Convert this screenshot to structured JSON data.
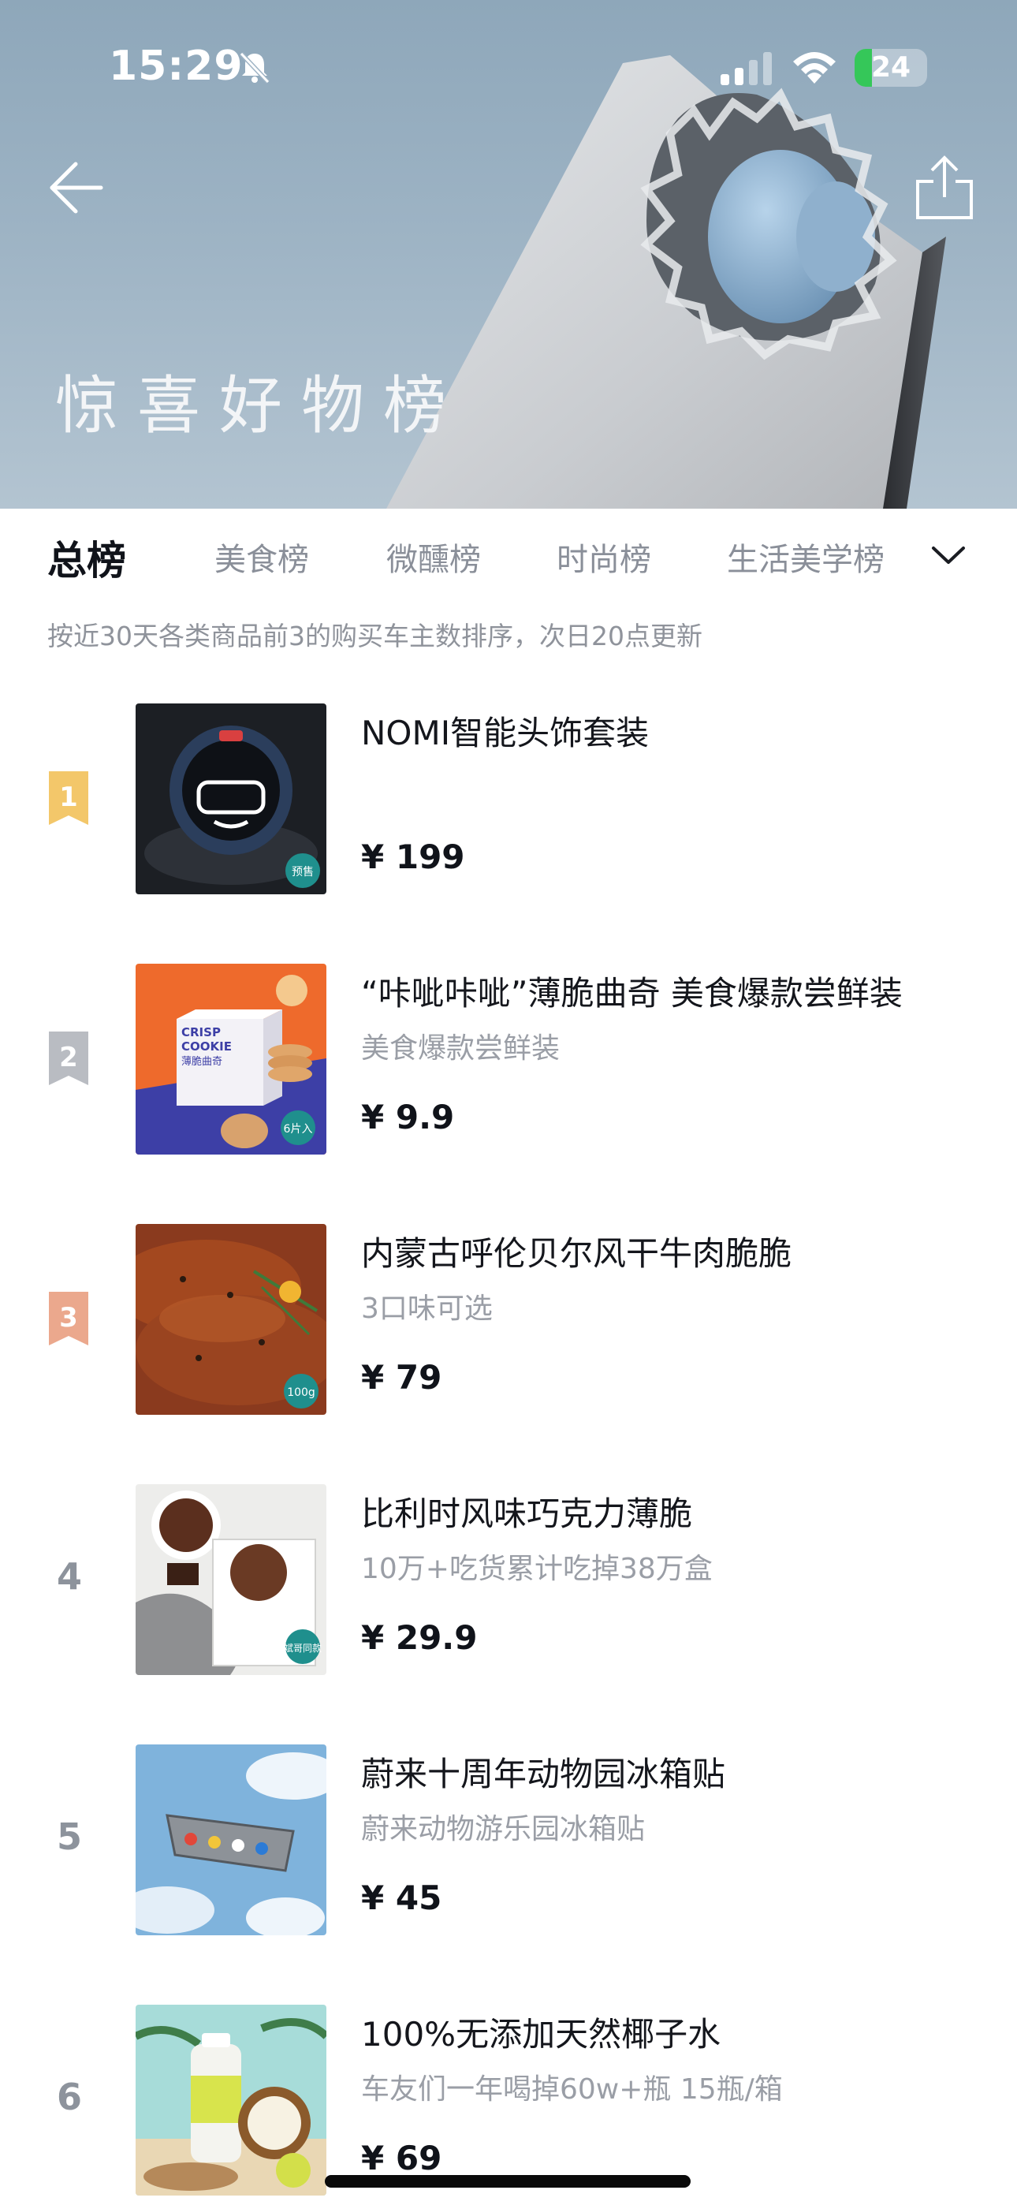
{
  "status_bar": {
    "time": "15:29",
    "battery": "24",
    "battery_level": 0.24
  },
  "hero": {
    "title": "惊喜好物榜"
  },
  "tabs": [
    {
      "label": "总榜",
      "active": true
    },
    {
      "label": "美食榜",
      "active": false
    },
    {
      "label": "微醺榜",
      "active": false
    },
    {
      "label": "时尚榜",
      "active": false
    },
    {
      "label": "生活美学榜",
      "active": false
    }
  ],
  "subtitle": "按近30天各类商品前3的购买车主数排序，次日20点更新",
  "products": [
    {
      "rank": "1",
      "title": "NOMI智能头饰套装",
      "desc": "",
      "price": "¥ 199",
      "tag": "预售",
      "badge_color": "#f3c76a"
    },
    {
      "rank": "2",
      "title": "“咔呲咔呲”薄脆曲奇 美食爆款尝鲜装",
      "desc": "美食爆款尝鲜装",
      "price": "¥ 9.9",
      "tag": "6片入",
      "badge_color": "#b9bcc2",
      "box_text1": "CRISP",
      "box_text2": "COOKIE",
      "box_text3": "薄脆曲奇"
    },
    {
      "rank": "3",
      "title": "内蒙古呼伦贝尔风干牛肉脆脆",
      "desc": "3口味可选",
      "price": "¥ 79",
      "tag": "100g",
      "badge_color": "#eba88d"
    },
    {
      "rank": "4",
      "title": "比利时风味巧克力薄脆",
      "desc": "10万+吃货累计吃掉38万盒",
      "price": "¥ 29.9",
      "tag": "斌哥同款"
    },
    {
      "rank": "5",
      "title": "蔚来十周年动物园冰箱贴",
      "desc": "蔚来动物游乐园冰箱贴",
      "price": "¥ 45"
    },
    {
      "rank": "6",
      "title": "100%无添加天然椰子水",
      "desc": "车友们一年喝掉60w+瓶 15瓶/箱",
      "price": "¥ 69"
    }
  ],
  "colors": {
    "accent_teal": "#1f8f8d",
    "text_primary": "#14161c",
    "text_secondary": "#9a9ea6"
  }
}
